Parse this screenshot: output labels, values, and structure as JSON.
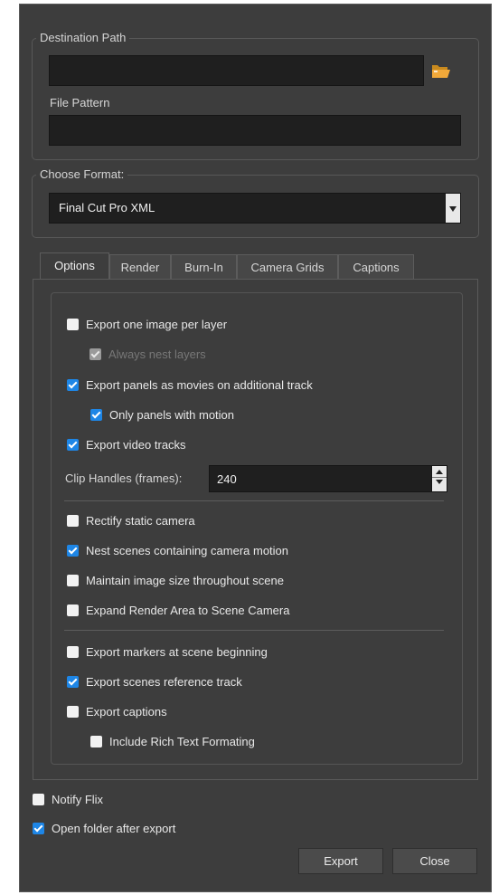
{
  "destination": {
    "title": "Destination Path",
    "path_value": "",
    "file_pattern_label": "File Pattern",
    "file_pattern_value": "",
    "browse_icon": "folder-icon"
  },
  "format": {
    "title": "Choose Format:",
    "selected": "Final Cut Pro XML"
  },
  "tabs": [
    "Options",
    "Render",
    "Burn-In",
    "Camera Grids",
    "Captions"
  ],
  "options": {
    "export_one_image": {
      "label": "Export one image per layer",
      "checked": false
    },
    "always_nest": {
      "label": "Always nest layers",
      "checked": true,
      "disabled": true
    },
    "export_panels_movies": {
      "label": "Export panels as movies on additional track",
      "checked": true
    },
    "only_panels_motion": {
      "label": "Only panels with motion",
      "checked": true
    },
    "export_video_tracks": {
      "label": "Export video tracks",
      "checked": true
    },
    "clip_handles_label": "Clip Handles (frames):",
    "clip_handles_value": "240",
    "rectify_static": {
      "label": "Rectify static camera",
      "checked": false
    },
    "nest_scenes_motion": {
      "label": "Nest scenes containing camera motion",
      "checked": true
    },
    "maintain_image_size": {
      "label": "Maintain image size throughout scene",
      "checked": false
    },
    "expand_render_area": {
      "label": "Expand Render Area to Scene Camera",
      "checked": false
    },
    "export_markers": {
      "label": "Export markers at scene beginning",
      "checked": false
    },
    "export_scenes_ref": {
      "label": "Export scenes reference track",
      "checked": true
    },
    "export_captions": {
      "label": "Export captions",
      "checked": false
    },
    "include_rich_text": {
      "label": "Include Rich Text Formating",
      "checked": false
    }
  },
  "footer": {
    "notify_flix": {
      "label": "Notify Flix",
      "checked": false
    },
    "open_folder": {
      "label": "Open folder after export",
      "checked": true
    },
    "export_button": "Export",
    "close_button": "Close"
  },
  "colors": {
    "accent": "#1e86e6",
    "background": "#3d3d3d",
    "field": "#1f1f1f"
  }
}
